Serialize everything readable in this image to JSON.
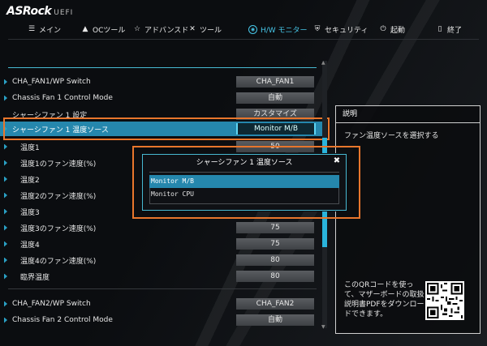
{
  "brand": {
    "name": "ASRock",
    "suffix": "UEFI"
  },
  "nav": [
    {
      "label": "メイン",
      "icon": "menu-icon",
      "glyph": "☰",
      "active": false
    },
    {
      "label": "OCツール",
      "icon": "rocket-icon",
      "glyph": "▲",
      "active": false
    },
    {
      "label": "アドバンスド",
      "icon": "star-icon",
      "glyph": "☆",
      "active": false
    },
    {
      "label": "ツール",
      "icon": "tools-icon",
      "glyph": "✕",
      "active": false
    },
    {
      "label": "H/W モニター",
      "icon": "monitor-icon",
      "glyph": "◉",
      "active": true
    },
    {
      "label": "セキュリティ",
      "icon": "shield-icon",
      "glyph": "⛨",
      "active": false
    },
    {
      "label": "起動",
      "icon": "power-icon",
      "glyph": "⏻",
      "active": false
    },
    {
      "label": "終了",
      "icon": "exit-icon",
      "glyph": "▯",
      "active": false
    }
  ],
  "settings": [
    {
      "label": "CHA_FAN1/WP Switch",
      "value": "CHA_FAN1",
      "marker": true,
      "sub": false
    },
    {
      "label": "Chassis Fan 1 Control Mode",
      "value": "自動",
      "marker": true,
      "sub": false
    },
    {
      "label": "シャーシファン 1 設定",
      "value": "カスタマイズ",
      "marker": false,
      "sub": false
    },
    {
      "label": "シャーシファン 1 温度ソース",
      "value": "Monitor M/B",
      "marker": true,
      "sub": false,
      "selected": true
    },
    {
      "label": "温度1",
      "value": "50",
      "marker": true,
      "sub": true
    },
    {
      "label": "温度1のファン速度(%)",
      "value": "",
      "marker": true,
      "sub": true
    },
    {
      "label": "温度2",
      "value": "",
      "marker": true,
      "sub": true
    },
    {
      "label": "温度2のファン速度(%)",
      "value": "",
      "marker": true,
      "sub": true
    },
    {
      "label": "温度3",
      "value": "",
      "marker": true,
      "sub": true
    },
    {
      "label": "温度3のファン速度(%)",
      "value": "75",
      "marker": true,
      "sub": true
    },
    {
      "label": "温度4",
      "value": "75",
      "marker": true,
      "sub": true
    },
    {
      "label": "温度4のファン速度(%)",
      "value": "80",
      "marker": true,
      "sub": true
    },
    {
      "label": "臨界温度",
      "value": "80",
      "marker": true,
      "sub": true
    },
    {
      "label": "CHA_FAN2/WP Switch",
      "value": "CHA_FAN2",
      "marker": true,
      "sub": false
    },
    {
      "label": "Chassis Fan 2 Control Mode",
      "value": "自動",
      "marker": true,
      "sub": false
    }
  ],
  "description": {
    "title": "説明",
    "text": "ファン温度ソースを選択する",
    "qr_text": "このQRコードを使って、マザーボードの取扱説明書PDFをダウンロードできます。"
  },
  "popup": {
    "title": "シャーシファン 1 温度ソース",
    "close_icon": "close-icon",
    "options": [
      "Monitor M/B",
      "Monitor CPU"
    ],
    "selected_index": 0
  },
  "colors": {
    "accent": "#2587ad",
    "highlight": "#e8762c",
    "cyan": "#47c6e8"
  }
}
